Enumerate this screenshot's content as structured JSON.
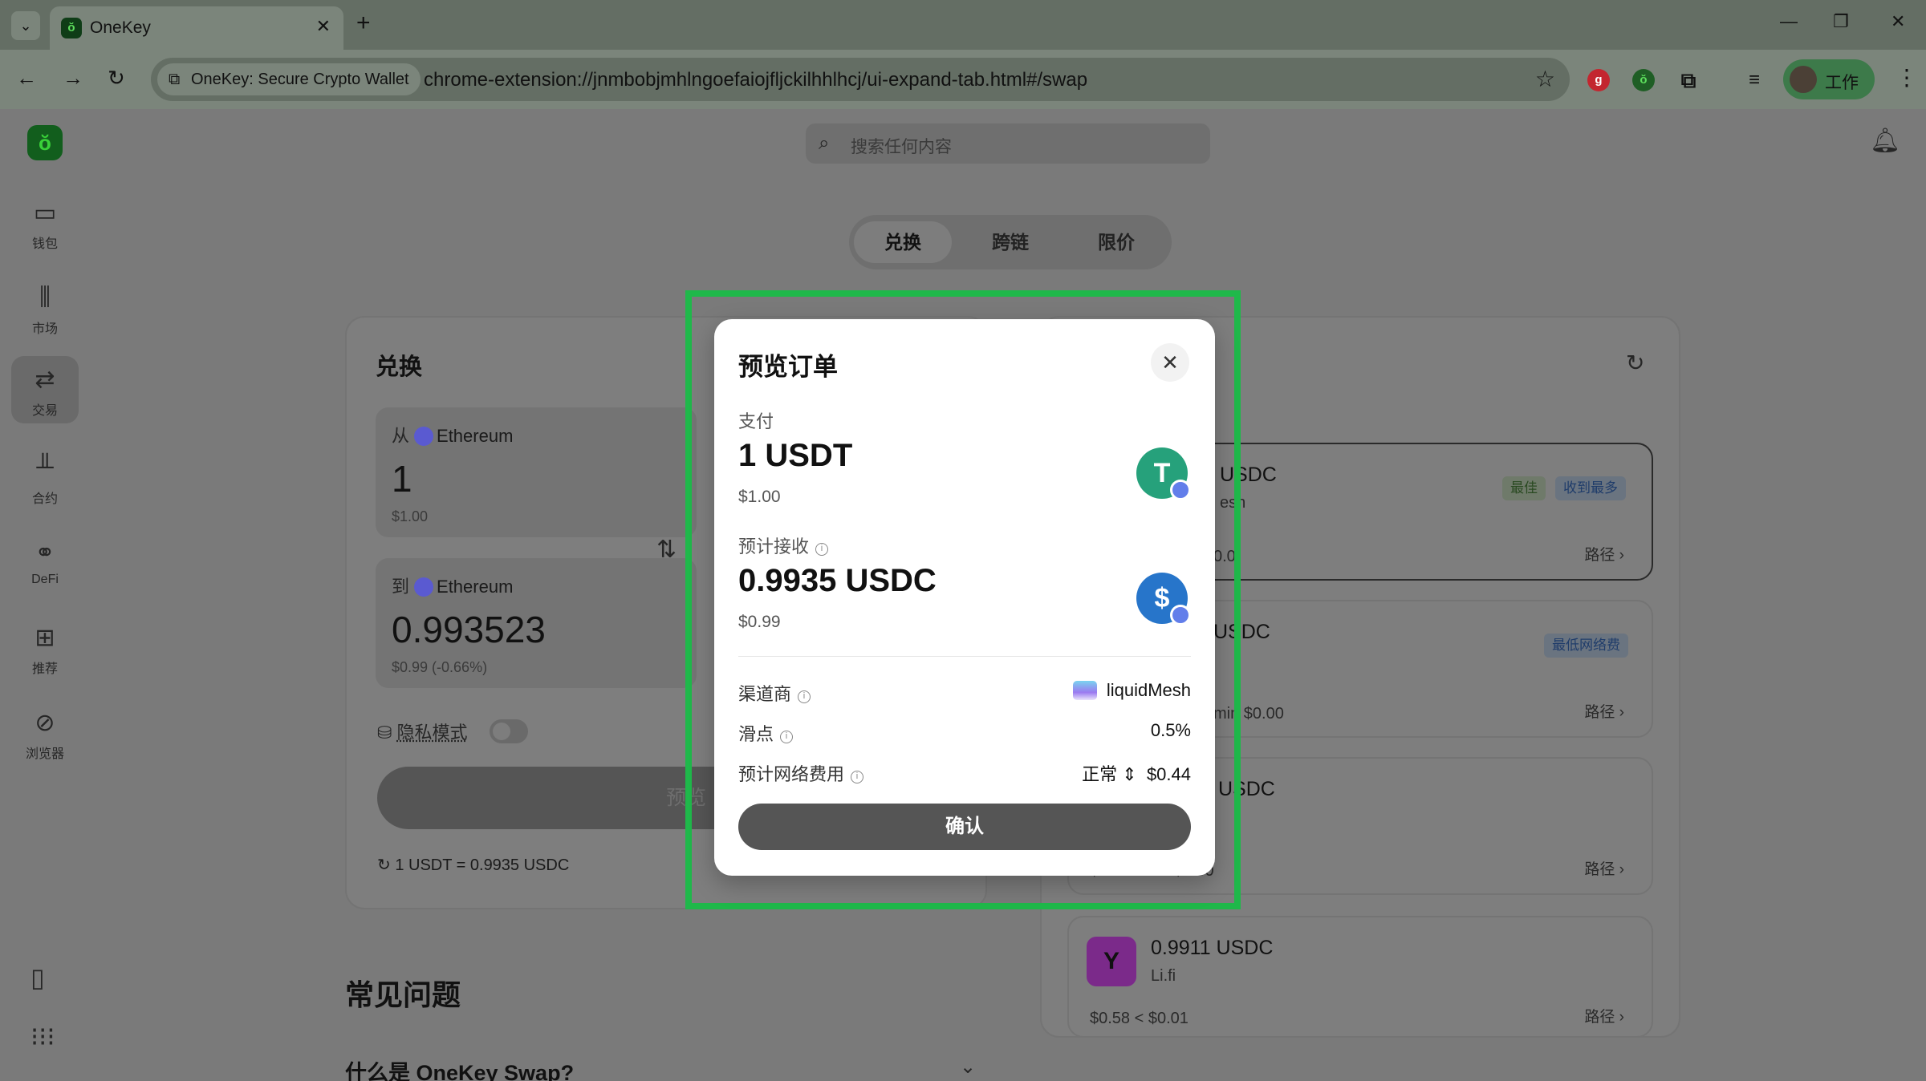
{
  "browser": {
    "tab_title": "OneKey",
    "new_tab": "+",
    "site_chip": "OneKey: Secure Crypto Wallet",
    "url": "chrome-extension://jnmbobjmhlngoefaiojfljckilhhlhcj/ui-expand-tab.html#/swap",
    "profile_label": "工作"
  },
  "sidebar": {
    "items": [
      {
        "label": "钱包",
        "icon": "wallet-icon"
      },
      {
        "label": "市场",
        "icon": "market-icon"
      },
      {
        "label": "交易",
        "icon": "swap-icon"
      },
      {
        "label": "合约",
        "icon": "perps-icon"
      },
      {
        "label": "DeFi",
        "icon": "defi-icon"
      },
      {
        "label": "推荐",
        "icon": "gift-icon"
      },
      {
        "label": "浏览器",
        "icon": "browser-icon"
      }
    ]
  },
  "header": {
    "search_placeholder": "搜索任何内容"
  },
  "mode_tabs": [
    "兑换",
    "跨链",
    "限价"
  ],
  "swap": {
    "title": "兑换",
    "from_label": "从",
    "from_chain": "Ethereum",
    "from_amount": "1",
    "from_usd": "$1.00",
    "to_label": "到",
    "to_chain": "Ethereum",
    "to_amount": "0.993523",
    "to_usd": "$0.99 (-0.66%)",
    "privacy_label": "隐私模式",
    "preview_button": "预览",
    "rate": "1 USDT = 0.9935 USDC"
  },
  "faq": {
    "title": "常见问题",
    "q1": "什么是 OneKey Swap?"
  },
  "routes": [
    {
      "amount": "USDC",
      "provider": "esh",
      "badges": [
        "最佳",
        "收到最多"
      ],
      "meta": "0.0",
      "path": "路径"
    },
    {
      "amount": "USDC",
      "provider": "",
      "badges": [
        "最低网络费"
      ],
      "meta": "min   $0.00",
      "path": "路径"
    },
    {
      "amount": "USDC",
      "provider": "",
      "badges": [],
      "meta": "$0.20   1min   $0.00",
      "path": "路径"
    },
    {
      "amount": "0.9911 USDC",
      "provider": "Li.fi",
      "badges": [],
      "meta": "$0.58   < $0.01",
      "path": "路径"
    }
  ],
  "modal": {
    "title": "预览订单",
    "pay_label": "支付",
    "pay_amount": "1 USDT",
    "pay_usd": "$1.00",
    "receive_label": "预计接收",
    "receive_amount": "0.9935 USDC",
    "receive_usd": "$0.99",
    "provider_label": "渠道商",
    "provider_value": "liquidMesh",
    "slippage_label": "滑点",
    "slippage_value": "0.5%",
    "fee_label": "预计网络费用",
    "fee_speed": "正常",
    "fee_value": "$0.44",
    "confirm_button": "确认"
  },
  "colors": {
    "highlight": "#1fb84a",
    "usdt": "#26a17b",
    "usdc": "#2775ca",
    "ethereum": "#627eea",
    "onekey_green": "#39d139"
  }
}
